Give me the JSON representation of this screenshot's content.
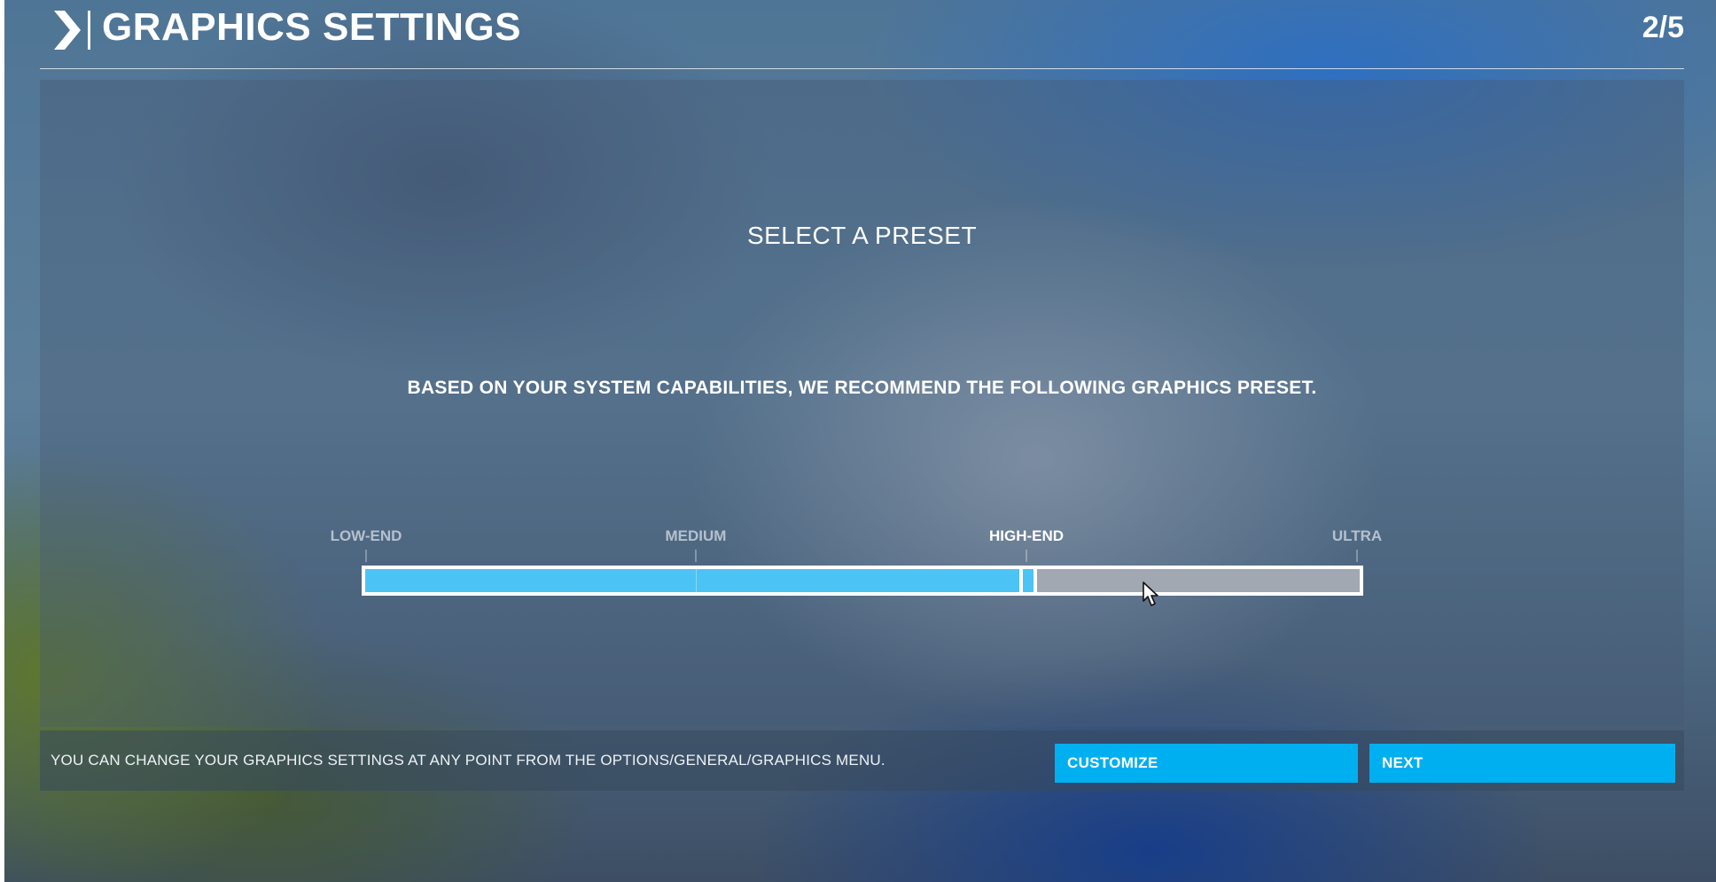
{
  "header": {
    "title": "GRAPHICS SETTINGS",
    "step": "2/5"
  },
  "main": {
    "heading": "SELECT A PRESET",
    "recommendation": "BASED ON YOUR SYSTEM CAPABILITIES, WE RECOMMEND THE FOLLOWING GRAPHICS PRESET."
  },
  "slider": {
    "presets": [
      {
        "label": "LOW-END"
      },
      {
        "label": "MEDIUM"
      },
      {
        "label": "HIGH-END"
      },
      {
        "label": "ULTRA"
      }
    ],
    "selected_index": 2,
    "selected_label": "HIGH-END",
    "fill_fraction": 0.667,
    "fill_color": "#4cc3f5",
    "track_color": "#a1a8b2"
  },
  "footer": {
    "note": "YOU CAN CHANGE YOUR GRAPHICS SETTINGS AT ANY POINT FROM THE OPTIONS/GENERAL/GRAPHICS MENU.",
    "customize_label": "CUSTOMIZE",
    "next_label": "NEXT",
    "button_color": "#00aff0"
  },
  "icons": {
    "header": "chevron-right-icon",
    "pointer": "mouse-cursor-icon"
  }
}
